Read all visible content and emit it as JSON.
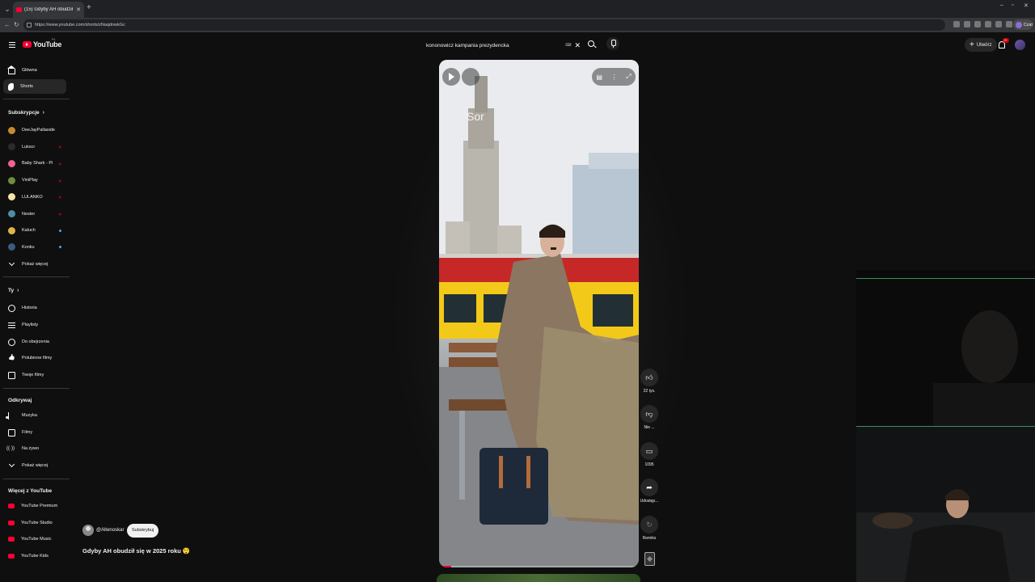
{
  "browser": {
    "tab_title": "(15) Gdyby AH obudził się w 2025",
    "url": "https://www.youtube.com/shorts/zNaqdowkGc",
    "profile_label": "Czat"
  },
  "header": {
    "logo_text": "YouTube",
    "logo_country": "PL",
    "search_query": "kononowicz kampania prezydencka",
    "create_label": "Utwórz",
    "notification_count": "9+"
  },
  "sidebar": {
    "main": [
      {
        "label": "Główna",
        "icon": "home-icon"
      },
      {
        "label": "Shorts",
        "icon": "shorts-icon",
        "active": true
      }
    ],
    "subscriptions_heading": "Subskrypcje",
    "subscriptions": [
      {
        "label": "DeeJayPallaside",
        "color": "#c88a2e",
        "badge": ""
      },
      {
        "label": "Lukscr",
        "color": "#2b2b2b",
        "badge": "live"
      },
      {
        "label": "Baby Shark - Pin...",
        "color": "#f06292",
        "badge": "live"
      },
      {
        "label": "ViniPlay",
        "color": "#6d8f3c",
        "badge": "live"
      },
      {
        "label": "LULANKO",
        "color": "#f5e6a3",
        "badge": "live"
      },
      {
        "label": "Nester",
        "color": "#4d8fa6",
        "badge": "live"
      },
      {
        "label": "Kaluch",
        "color": "#e2b548",
        "badge": "dot"
      },
      {
        "label": "Konku",
        "color": "#3d5a80",
        "badge": "dot"
      }
    ],
    "show_more_1": "Pokaż więcej",
    "you_heading": "Ty",
    "you": [
      {
        "label": "Historia",
        "icon": "history-icon"
      },
      {
        "label": "Playlisty",
        "icon": "playlists-icon"
      },
      {
        "label": "Do obejrzenia",
        "icon": "watch-later-icon"
      },
      {
        "label": "Polubione filmy",
        "icon": "liked-videos-icon"
      },
      {
        "label": "Twoje filmy",
        "icon": "your-videos-icon"
      }
    ],
    "explore_heading": "Odkrywaj",
    "explore": [
      {
        "label": "Muzyka",
        "icon": "music-icon"
      },
      {
        "label": "Filmy",
        "icon": "movies-icon"
      },
      {
        "label": "Na żywo",
        "icon": "live-icon"
      }
    ],
    "show_more_2": "Pokaż więcej",
    "more_heading": "Więcej z YouTube",
    "more": [
      {
        "label": "YouTube Premium"
      },
      {
        "label": "YouTube Studio"
      },
      {
        "label": "YouTube Music"
      },
      {
        "label": "YouTube Kids"
      }
    ]
  },
  "short": {
    "overlay_text": "Sor",
    "channel": "@Altenoskar",
    "subscribe_label": "Subskrybuj",
    "title": "Gdyby AH obudził się w 2025 roku 😲",
    "progress_fraction": 0.06,
    "actions": {
      "likes": "22 tys.",
      "dislike": "Nie ...",
      "comments": "1095",
      "share": "Udostęp...",
      "remix": "Remiks"
    }
  },
  "colors": {
    "accent": "#ff0033",
    "background": "#0f0f0f",
    "webcam_line": "#3f8d5a"
  }
}
